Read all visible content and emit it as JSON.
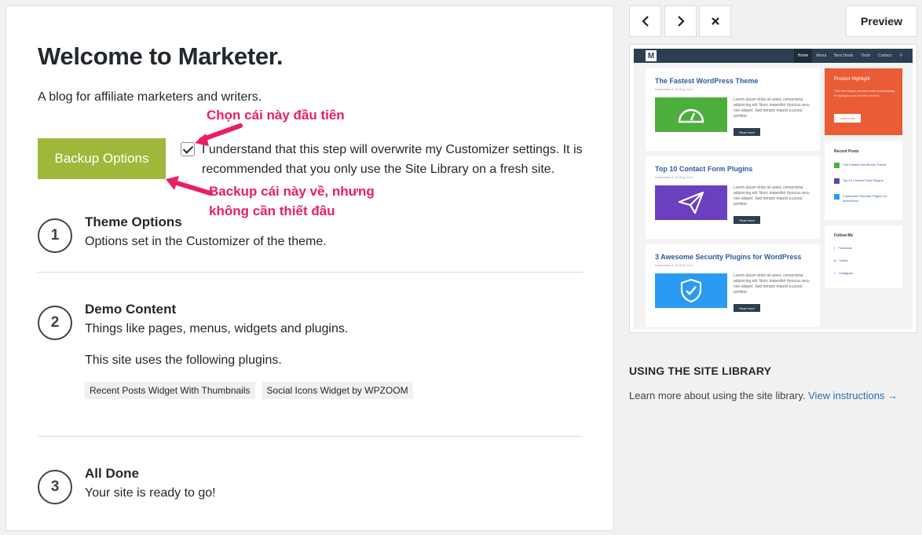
{
  "main": {
    "title": "Welcome to Marketer.",
    "subtitle": "A blog for affiliate marketers and writers.",
    "backup_button": "Backup Options",
    "confirm_checked": true,
    "confirm_text": "I understand that this step will overwrite my Customizer settings. It is recommended that you only use the Site Library on a fresh site.",
    "steps": [
      {
        "number": "1",
        "title": "Theme Options",
        "desc": "Options set in the Customizer of the theme."
      },
      {
        "number": "2",
        "title": "Demo Content",
        "desc": "Things like pages, menus, widgets and plugins.",
        "extra": "This site uses the following plugins.",
        "plugins": [
          "Recent Posts Widget With Thumbnails",
          "Social Icons Widget by WPZOOM"
        ]
      },
      {
        "number": "3",
        "title": "All Done",
        "desc": "Your site is ready to go!"
      }
    ]
  },
  "annotations": {
    "first": "Chọn cái này đầu tiên",
    "second_line1": "Backup cái này về, nhưng",
    "second_line2": "không cần thiết đâu",
    "color": "#e91e63"
  },
  "toolbar": {
    "prev_icon": "chevron-left-icon",
    "next_icon": "chevron-right-icon",
    "close_icon": "close-icon",
    "preview_label": "Preview"
  },
  "thumbnail": {
    "logo": "M",
    "menu": [
      "Home",
      "About",
      "Best Deals",
      "Tools",
      "Contact"
    ],
    "posts": [
      {
        "title": "The Fastest WordPress Theme",
        "meta": "September 8, 2018 by Tom",
        "excerpt": "Lorem ipsum dolor sit amet, consectetur adipiscing elit. Nunc imperdiet rhoncus arcu non aliquet. Sed tempor mauris a purus porttitor.",
        "read_more": "Read more",
        "color": "#4caf3c"
      },
      {
        "title": "Top 10 Contact Form Plugins",
        "meta": "September 8, 2018 by Tom",
        "excerpt": "Lorem ipsum dolor sit amet, consectetur adipiscing elit. Nunc imperdiet rhoncus arcu non aliquet. Sed tempor mauris a purus porttitor.",
        "read_more": "Read more",
        "color": "#6a3fc0"
      },
      {
        "title": "3 Awesome Security Plugins for WordPress",
        "meta": "September 8, 2018 by Tom",
        "excerpt": "Lorem ipsum dolor sit amet, consectetur adipiscing elit. Nunc imperdiet rhoncus arcu non aliquet. Sed tempor mauris a purus porttitor.",
        "read_more": "Read more",
        "color": "#2b9af3"
      }
    ],
    "highlight": {
      "title": "Product Highlight",
      "text": "This first widget will style itself automatically to highlight your favorite product.",
      "button": "Learn more"
    },
    "recent_posts_title": "Recent Posts",
    "recent_posts": [
      "The Fastest WordPress Theme",
      "Top 10 Contact Form Plugins",
      "3 Awesome Security Plugins for WordPress"
    ],
    "follow_title": "Follow Me",
    "follow": [
      "Facebook",
      "Twitter",
      "Instagram"
    ]
  },
  "library": {
    "title": "USING THE SITE LIBRARY",
    "text": "Learn more about using the site library.",
    "link": "View instructions →"
  }
}
